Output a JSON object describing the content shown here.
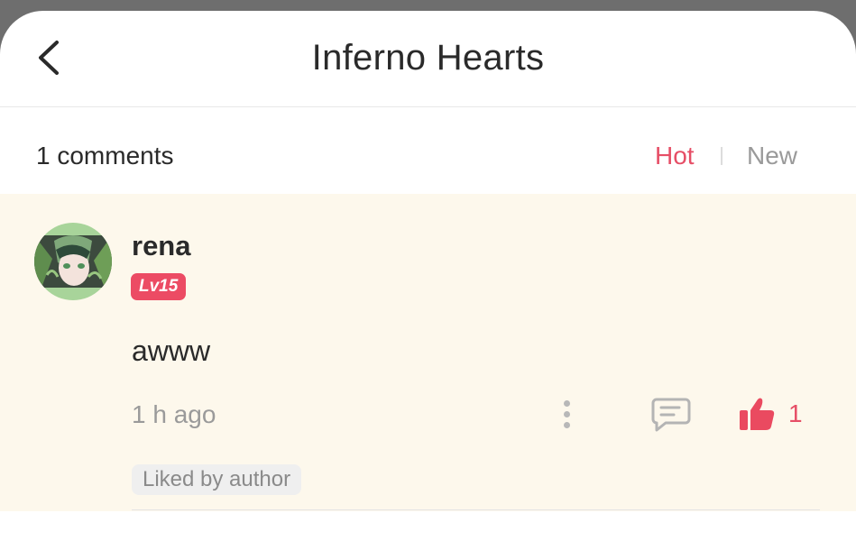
{
  "header": {
    "title": "Inferno Hearts",
    "back_icon": "chevron-left-icon"
  },
  "sort": {
    "count_label": "1 comments",
    "hot_label": "Hot",
    "new_label": "New",
    "active": "Hot",
    "active_color": "#e64e66"
  },
  "comment": {
    "username": "rena",
    "level": "Lv15",
    "text": "awww",
    "time": "1 h ago",
    "like_count": "1",
    "liked_by_author": "Liked by author",
    "highlight_bg": "#fdf8ec"
  }
}
